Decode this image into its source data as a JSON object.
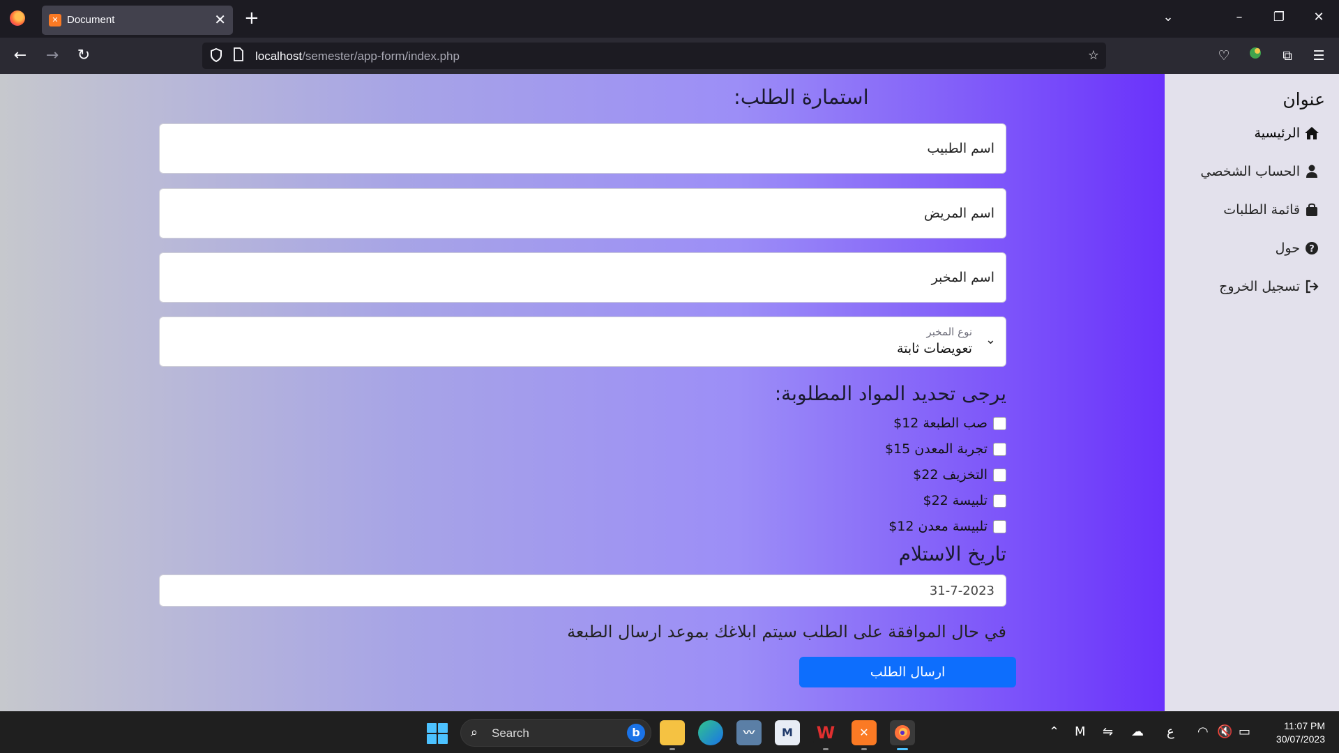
{
  "browser": {
    "tab_title": "Document",
    "url_host": "localhost",
    "url_path": "/semester/app-form/index.php"
  },
  "sidebar": {
    "title": "عنوان",
    "items": [
      {
        "label": "الرئيسية",
        "icon": "home-icon"
      },
      {
        "label": "الحساب الشخصي",
        "icon": "user-icon"
      },
      {
        "label": "قائمة الطلبات",
        "icon": "bag-icon"
      },
      {
        "label": "حول",
        "icon": "question-circle-icon"
      },
      {
        "label": "تسجيل الخروج",
        "icon": "logout-icon"
      }
    ]
  },
  "form": {
    "title": "استمارة الطلب:",
    "doctor_name_placeholder": "اسم الطبيب",
    "patient_name_placeholder": "اسم المريض",
    "lab_name_placeholder": "اسم المخبر",
    "lab_type_label": "نوع المخبر",
    "lab_type_value": "تعويضات ثابتة",
    "materials_heading": "يرجى تحديد المواد المطلوبة:",
    "materials": [
      "صب الطبعة 12$",
      "تجربة المعدن 15$",
      "التخزيف 22$",
      "تلبيسة 22$",
      "تلبيسة معدن 12$"
    ],
    "date_heading": "تاريخ الاستلام",
    "date_value": "31-7-2023",
    "notice": "في حال الموافقة على الطلب سيتم ابلاغك بموعد ارسال الطبعة",
    "submit_label": "ارسال الطلب"
  },
  "taskbar": {
    "search_label": "Search",
    "time": "11:07 PM",
    "date": "30/07/2023",
    "language": "ع"
  },
  "colors": {
    "accent": "#0d6efd",
    "gradient_end": "#6a32fb",
    "sidebar_bg": "#e3e1ec"
  }
}
